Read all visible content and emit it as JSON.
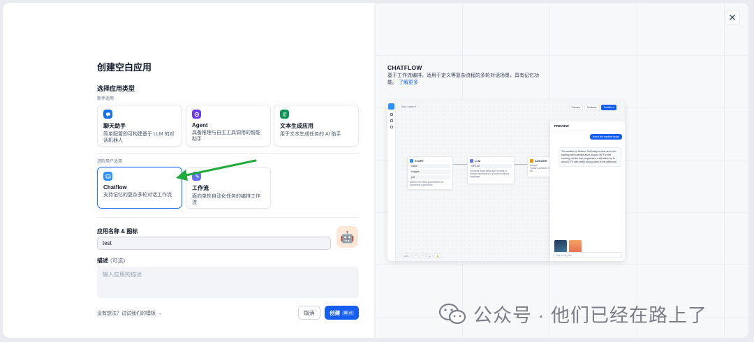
{
  "left": {
    "title": "创建空白应用",
    "type_section_title": "选择应用类型",
    "beginner_label": "新手适用",
    "advanced_label": "进阶用户适用",
    "beginner_cards": [
      {
        "title": "聊天助手",
        "desc": "简单配置即可构建基于 LLM 的对话机器人",
        "color": "#1570ef",
        "icon": "chat-bot-icon"
      },
      {
        "title": "Agent",
        "desc": "具备推理与自主工具调用的智能助手",
        "color": "#6938ef",
        "icon": "agent-icon"
      },
      {
        "title": "文本生成应用",
        "desc": "用于文本生成任务的 AI 助手",
        "color": "#079455",
        "icon": "text-generator-icon"
      }
    ],
    "advanced_cards": [
      {
        "title": "Chatflow",
        "desc": "支持记忆的复杂多轮对话工作流",
        "color": "#2e90fa",
        "icon": "chatflow-icon",
        "selected": true
      },
      {
        "title": "工作流",
        "desc": "面向单轮自动化任务的编排工作流",
        "color": "#6172f3",
        "icon": "workflow-icon",
        "selected": false
      }
    ],
    "name_label": "应用名称 & 图标",
    "name_value": "test",
    "desc_label": "描述",
    "desc_optional": "(可选)",
    "desc_placeholder": "输入应用的描述",
    "template_link": "没有想法？试试我们的模板 →",
    "cancel_label": "取消",
    "create_label": "创建",
    "create_kbd": "⌘ ↵"
  },
  "right": {
    "title": "CHATFLOW",
    "desc": "基于工作流编排，适用于定义等复杂流程的多轮对话场景，具有记忆功能。",
    "learn_more": "了解更多",
    "preview": {
      "app_title": "Auto-Saved 3 ·",
      "toolbar": [
        "Preview",
        "Features",
        "Publish ▾"
      ],
      "nodes": [
        {
          "title": "START",
          "rows": [
            "name",
            "Images",
            "pdf"
          ],
          "color": "#2e90fa",
          "foot": "Define the initial parameters for launching a workflow"
        },
        {
          "title": "LLM",
          "rows": [
            "GPT-4o"
          ],
          "color": "#6172f3",
          "foot": "Invoking large language models to answer questions or process natural language"
        },
        {
          "title": "ANSWER",
          "rows": [
            "Today's weather in Bu"
          ],
          "color": "#f79009",
          "foot": "answer"
        }
      ],
      "chat_header": "PREVIEW",
      "user_msg": "How's the weather today",
      "bot_msg": "The weather in Boston, MA today is clear and cool, starting with a temperature around 46°F in the morning. As the day progresses, it will warm up to about 70°F with partly cloudy skies in the afternoon.",
      "chat_input": "Talk to Dify Bot",
      "bottom_zoom": "100%"
    }
  },
  "watermark": "公众号 · 他们已经在路上了"
}
